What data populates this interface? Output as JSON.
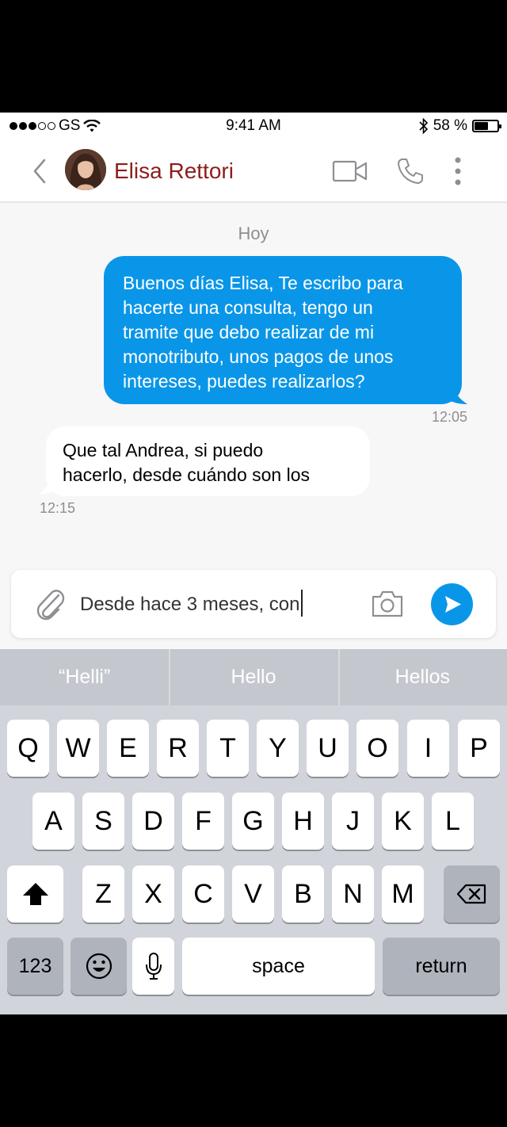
{
  "status_bar": {
    "carrier": "GS",
    "time": "9:41 AM",
    "battery": "58 %",
    "battery_level": 0.58
  },
  "header": {
    "contact_name": "Elisa Rettori",
    "icons": [
      "chevron-left-icon",
      "video-camera-icon",
      "phone-icon",
      "more-vertical-icon"
    ]
  },
  "chat": {
    "day_label": "Hoy",
    "messages": [
      {
        "direction": "outgoing",
        "lines": [
          "Buenos días Elisa, Te escribo para",
          "hacerte una consulta, tengo un",
          "tramite que debo realizar de mi",
          "monotributo, unos pagos de unos",
          "intereses, puedes realizarlos?"
        ],
        "time": "12:05"
      },
      {
        "direction": "incoming",
        "lines": [
          "Que tal Andrea, si puedo",
          "hacerlo, desde cuándo son los"
        ],
        "time": "12:15"
      }
    ]
  },
  "composer": {
    "text": "Desde hace 3 meses, con",
    "icons": [
      "paperclip-icon",
      "camera-icon",
      "send-icon"
    ]
  },
  "keyboard": {
    "suggestions": [
      "“Helli”",
      "Hello",
      "Hellos"
    ],
    "rows": [
      [
        "Q",
        "W",
        "E",
        "R",
        "T",
        "Y",
        "U",
        "O",
        "I",
        "P"
      ],
      [
        "A",
        "S",
        "D",
        "F",
        "G",
        "H",
        "J",
        "K",
        "L"
      ],
      [
        "Z",
        "X",
        "C",
        "V",
        "B",
        "N",
        "M"
      ]
    ],
    "numbers_label": "123",
    "space_label": "space",
    "return_label": "return"
  },
  "colors": {
    "accent": "#0A96E8",
    "contact_name": "#8C1D1D",
    "meta_text": "#8E8E93"
  }
}
